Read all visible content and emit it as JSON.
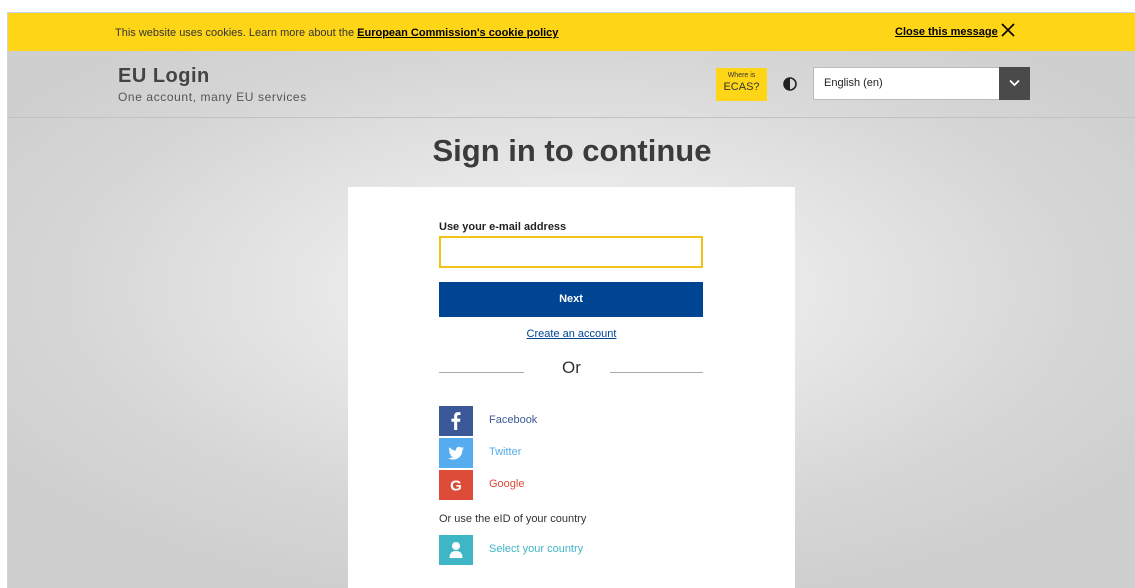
{
  "cookie_bar": {
    "text": "This website uses cookies. Learn more about the ",
    "link_label": "European Commission's cookie policy",
    "close_label": "Close this message"
  },
  "header": {
    "title": "EU Login",
    "subtitle": "One account, many EU services",
    "ecas_small": "Where is",
    "ecas_big": "ECAS?",
    "language_selected": "English (en)"
  },
  "main": {
    "page_title": "Sign in to continue",
    "email_label": "Use your e-mail address",
    "email_value": "",
    "next_label": "Next",
    "create_account_label": "Create an account",
    "or_label": "Or",
    "social": {
      "facebook": {
        "label": "Facebook",
        "color": "#3b5998",
        "text_color": "#3b5998"
      },
      "twitter": {
        "label": "Twitter",
        "color": "#55acee",
        "text_color": "#55acee"
      },
      "google": {
        "label": "Google",
        "color": "#dd4b39",
        "text_color": "#dd4b39"
      }
    },
    "eid_label": "Or use the eID of your country",
    "select_country_label": "Select your country",
    "select_country_color": "#3fb6c6"
  },
  "colors": {
    "cookie_bar": "#ffd617",
    "primary_button": "#004494",
    "input_border": "#f2c316"
  }
}
